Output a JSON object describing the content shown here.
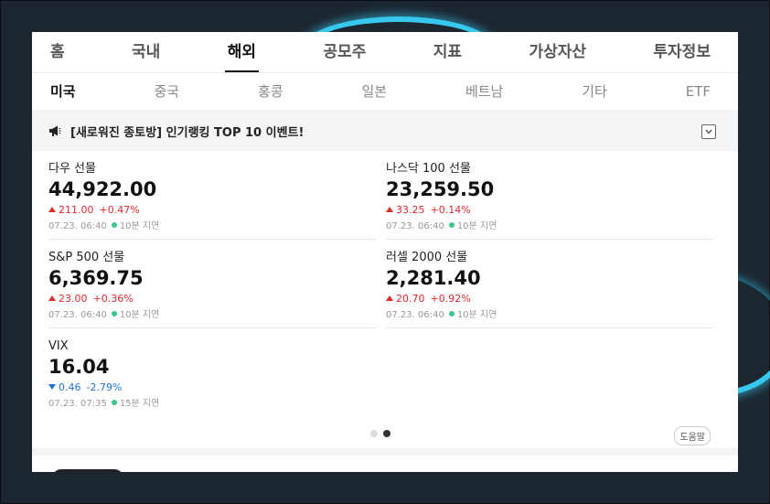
{
  "tabs_primary": [
    {
      "label": "홈"
    },
    {
      "label": "국내"
    },
    {
      "label": "해외",
      "active": true
    },
    {
      "label": "공모주"
    },
    {
      "label": "지표"
    },
    {
      "label": "가상자산"
    },
    {
      "label": "투자정보"
    }
  ],
  "tabs_secondary": [
    {
      "label": "미국",
      "active": true
    },
    {
      "label": "중국"
    },
    {
      "label": "홍콩"
    },
    {
      "label": "일본"
    },
    {
      "label": "베트남"
    },
    {
      "label": "기타"
    },
    {
      "label": "ETF"
    }
  ],
  "banner": {
    "icon": "megaphone-icon",
    "text": "[새로워진 종토방] 인기랭킹 TOP 10 이벤트!"
  },
  "indices": [
    {
      "name": "다우 선물",
      "value": "44,922.00",
      "direction": "up",
      "change": "211.00",
      "pct": "+0.47%",
      "time": "07.23. 06:40",
      "delay": "10분 지연"
    },
    {
      "name": "나스닥 100 선물",
      "value": "23,259.50",
      "direction": "up",
      "change": "33.25",
      "pct": "+0.14%",
      "time": "07.23. 06:40",
      "delay": "10분 지연"
    },
    {
      "name": "S&P 500 선물",
      "value": "6,369.75",
      "direction": "up",
      "change": "23.00",
      "pct": "+0.36%",
      "time": "07.23. 06:40",
      "delay": "10분 지연"
    },
    {
      "name": "러셀 2000 선물",
      "value": "2,281.40",
      "direction": "up",
      "change": "20.70",
      "pct": "+0.92%",
      "time": "07.23. 06:40",
      "delay": "10분 지연"
    },
    {
      "name": "VIX",
      "value": "16.04",
      "direction": "down",
      "change": "0.46",
      "pct": "-2.79%",
      "time": "07.23. 07:35",
      "delay": "15분 지연"
    }
  ],
  "pager": {
    "pages": 2,
    "current": 2
  },
  "help_label": "도움말",
  "colors": {
    "up": "#e02a2a",
    "down": "#1f73d6",
    "delay_dot": "#3cc68a",
    "glow": "#38c8ee"
  }
}
